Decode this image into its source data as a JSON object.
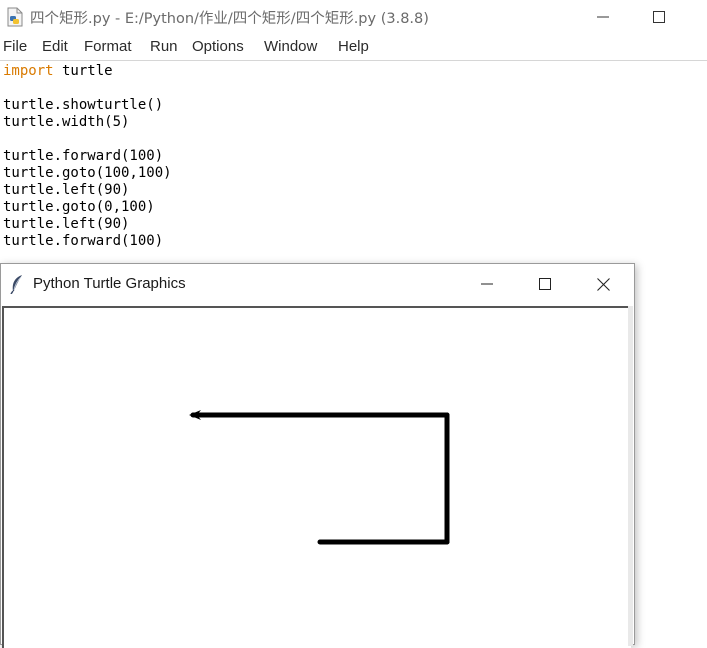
{
  "editor": {
    "title": "四个矩形.py - E:/Python/作业/四个矩形/四个矩形.py (3.8.8)",
    "app_icon": "python-file-icon",
    "controls": {
      "minimize_icon": "minimize-icon",
      "maximize_icon": "maximize-icon"
    },
    "menu": [
      "File",
      "Edit",
      "Format",
      "Run",
      "Options",
      "Window",
      "Help"
    ],
    "code": {
      "keyword_import": "import",
      "import_rest": " turtle",
      "lines": [
        "turtle.showturtle()",
        "turtle.width(5)",
        "turtle.forward(100)",
        "turtle.goto(100,100)",
        "turtle.left(90)",
        "turtle.goto(0,100)",
        "turtle.left(90)",
        "turtle.forward(100)"
      ]
    }
  },
  "turtle_window": {
    "title": "Python Turtle Graphics",
    "icon": "feather-icon",
    "controls": {
      "minimize_icon": "minimize-icon",
      "maximize_icon": "maximize-icon",
      "close_icon": "close-icon"
    },
    "drawing": {
      "pen_color": "#000000",
      "pen_width": 5,
      "path": [
        [
          0,
          0
        ],
        [
          100,
          0
        ],
        [
          100,
          100
        ],
        [
          0,
          100
        ],
        [
          -100,
          100
        ]
      ],
      "turtle_heading": 180
    }
  },
  "colors": {
    "keyword": "#d97a00",
    "menu_text": "#2b2b2b",
    "title_text": "#6b6b6b"
  }
}
